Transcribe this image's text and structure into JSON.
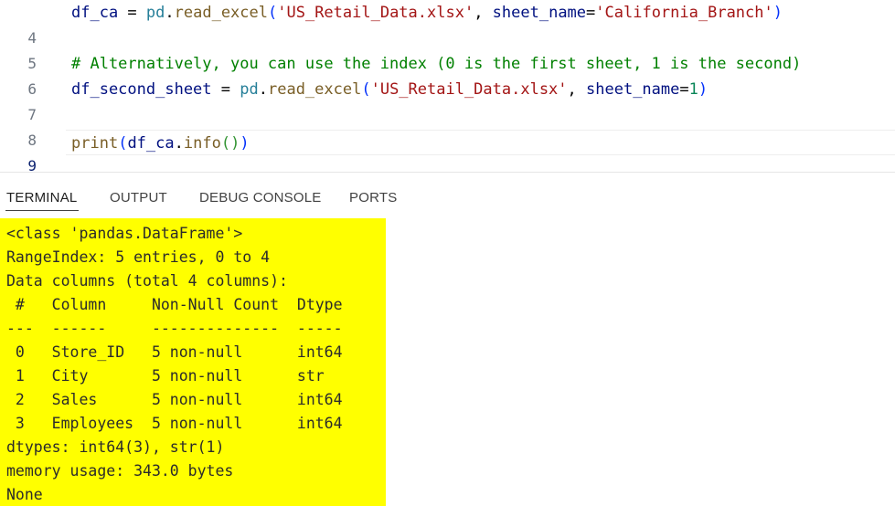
{
  "editor": {
    "lines": [
      {
        "num": "4",
        "code": "df_ca = pd.read_excel('US_Retail_Data.xlsx', sheet_name='California_Branch')"
      },
      {
        "num": "5",
        "code": ""
      },
      {
        "num": "6",
        "code": "# Alternatively, you can use the index (0 is the first sheet, 1 is the second)"
      },
      {
        "num": "7",
        "code": "df_second_sheet = pd.read_excel('US_Retail_Data.xlsx', sheet_name=1)"
      },
      {
        "num": "8",
        "code": ""
      },
      {
        "num": "9",
        "code": "print(df_ca.info())"
      }
    ]
  },
  "panel": {
    "tabs": [
      {
        "label": "TERMINAL",
        "active": true
      },
      {
        "label": "OUTPUT",
        "active": false
      },
      {
        "label": "DEBUG CONSOLE",
        "active": false
      },
      {
        "label": "PORTS",
        "active": false
      }
    ]
  },
  "terminal": {
    "highlight_color": "#ffff00",
    "lines": [
      "<class 'pandas.DataFrame'>",
      "RangeIndex: 5 entries, 0 to 4",
      "Data columns (total 4 columns):",
      " #   Column     Non-Null Count  Dtype",
      "---  ------     --------------  -----",
      " 0   Store_ID   5 non-null      int64",
      " 1   City       5 non-null      str",
      " 2   Sales      5 non-null      int64",
      " 3   Employees  5 non-null      int64",
      "dtypes: int64(3), str(1)",
      "memory usage: 343.0 bytes",
      "None"
    ]
  }
}
